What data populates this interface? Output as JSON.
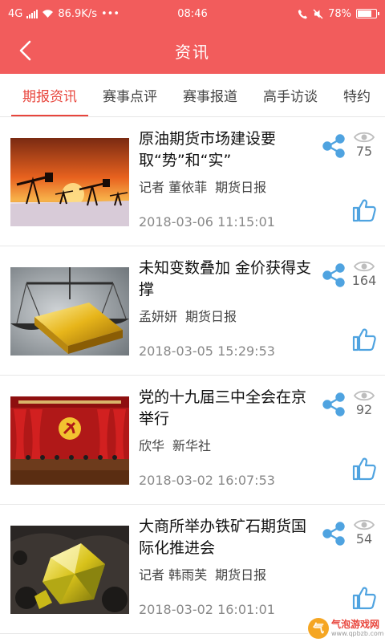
{
  "status_bar": {
    "network": "4G",
    "speed": "86.9K/s",
    "more": "•••",
    "time": "08:46",
    "battery": "78%",
    "battery_level": 0.78
  },
  "header": {
    "title": "资讯",
    "back_icon": "chevron-left-icon"
  },
  "tabs": [
    {
      "label": "期报资讯",
      "active": true
    },
    {
      "label": "赛事点评",
      "active": false
    },
    {
      "label": "赛事报道",
      "active": false
    },
    {
      "label": "高手访谈",
      "active": false
    },
    {
      "label": "特约",
      "active": false
    }
  ],
  "news": [
    {
      "title": "原油期货市场建设要取“势”和“实”",
      "author": "记者 董依菲",
      "source": "期货日报",
      "date": "2018-03-06 11:15:01",
      "views": "75",
      "image": "oil-pumpjacks-sunset"
    },
    {
      "title": "未知变数叠加 金价获得支撑",
      "author": "孟妍妍",
      "source": "期货日报",
      "date": "2018-03-05 15:29:53",
      "views": "164",
      "image": "gold-bar-scale"
    },
    {
      "title": "党的十九届三中全会在京举行",
      "author": "欣华",
      "source": "新华社",
      "date": "2018-03-02 16:07:53",
      "views": "92",
      "image": "plenary-session-hall"
    },
    {
      "title": "大商所举办铁矿石期货国际化推进会",
      "author": "记者 韩雨芙",
      "source": "期货日报",
      "date": "2018-03-02 16:01:01",
      "views": "54",
      "image": "mineral-crystal"
    }
  ],
  "watermark": {
    "main": "气泡游戏网",
    "sub": "www.qpbzb.com",
    "logo_char": "气"
  },
  "colors": {
    "brand_red": "#f25c5c",
    "tab_active": "#e8453c",
    "icon_blue": "#4fa3e0"
  }
}
